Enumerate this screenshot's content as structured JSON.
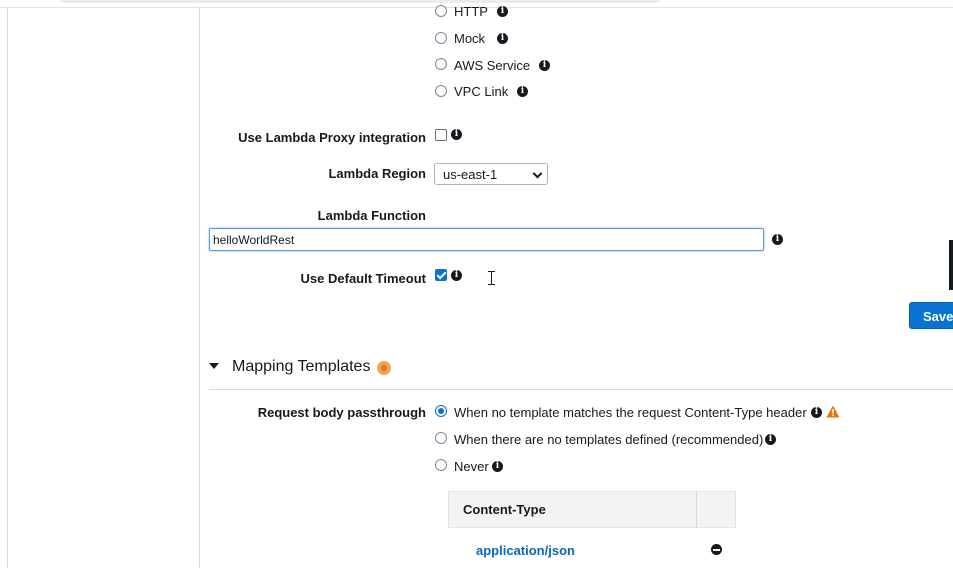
{
  "integration_types": [
    {
      "label": "HTTP",
      "checked": false
    },
    {
      "label": "Mock",
      "checked": false
    },
    {
      "label": "AWS Service",
      "checked": false
    },
    {
      "label": "VPC Link",
      "checked": false
    }
  ],
  "proxy_integration": {
    "label": "Use Lambda Proxy integration",
    "checked": false
  },
  "lambda_region": {
    "label": "Lambda Region",
    "value": "us-east-1"
  },
  "lambda_function": {
    "label": "Lambda Function",
    "value": "helloWorldRest"
  },
  "default_timeout": {
    "label": "Use Default Timeout",
    "checked": true
  },
  "save_button": {
    "label": "Save"
  },
  "mapping_templates": {
    "title": "Mapping Templates",
    "passthrough_label": "Request body passthrough",
    "options": [
      {
        "label": "When no template matches the request Content-Type header",
        "checked": true
      },
      {
        "label": "When there are no templates defined (recommended)",
        "checked": false
      },
      {
        "label": "Never",
        "checked": false
      }
    ],
    "table_header": "Content-Type",
    "rows": [
      "application/json"
    ]
  },
  "info_glyph": "i",
  "colors": {
    "accent": "#0972d3",
    "warning": "#ec7211",
    "link": "#0b67b8"
  }
}
